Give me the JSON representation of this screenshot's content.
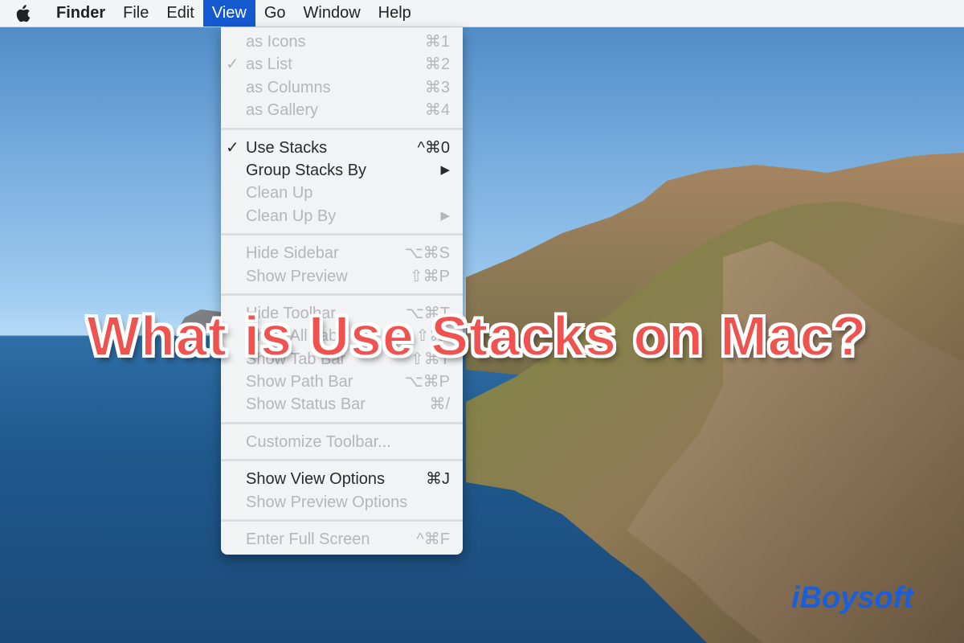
{
  "menubar": {
    "apple_icon": "apple-logo-icon",
    "items": [
      "Finder",
      "File",
      "Edit",
      "View",
      "Go",
      "Window",
      "Help"
    ],
    "active_item": "View"
  },
  "view_menu": {
    "groups": [
      [
        {
          "label": "as Icons",
          "shortcut": "⌘1",
          "enabled": false,
          "checked": false
        },
        {
          "label": "as List",
          "shortcut": "⌘2",
          "enabled": false,
          "checked": true
        },
        {
          "label": "as Columns",
          "shortcut": "⌘3",
          "enabled": false,
          "checked": false
        },
        {
          "label": "as Gallery",
          "shortcut": "⌘4",
          "enabled": false,
          "checked": false
        }
      ],
      [
        {
          "label": "Use Stacks",
          "shortcut": "^⌘0",
          "enabled": true,
          "checked": true
        },
        {
          "label": "Group Stacks By",
          "shortcut": "▶",
          "enabled": true,
          "checked": false
        },
        {
          "label": "Clean Up",
          "shortcut": "",
          "enabled": false,
          "checked": false
        },
        {
          "label": "Clean Up By",
          "shortcut": "▶",
          "enabled": false,
          "checked": false
        }
      ],
      [
        {
          "label": "Hide Sidebar",
          "shortcut": "⌥⌘S",
          "enabled": false,
          "checked": false
        },
        {
          "label": "Show Preview",
          "shortcut": "⇧⌘P",
          "enabled": false,
          "checked": false
        }
      ],
      [
        {
          "label": "Hide Toolbar",
          "shortcut": "⌥⌘T",
          "enabled": false,
          "checked": false
        },
        {
          "label": "Show All Tabs",
          "shortcut": "⇧⌘\\",
          "enabled": false,
          "checked": false
        },
        {
          "label": "Show Tab Bar",
          "shortcut": "⇧⌘T",
          "enabled": false,
          "checked": false
        },
        {
          "label": "Show Path Bar",
          "shortcut": "⌥⌘P",
          "enabled": false,
          "checked": false
        },
        {
          "label": "Show Status Bar",
          "shortcut": "⌘/",
          "enabled": false,
          "checked": false
        }
      ],
      [
        {
          "label": "Customize Toolbar...",
          "shortcut": "",
          "enabled": false,
          "checked": false
        }
      ],
      [
        {
          "label": "Show View Options",
          "shortcut": "⌘J",
          "enabled": true,
          "checked": false
        },
        {
          "label": "Show Preview Options",
          "shortcut": "",
          "enabled": false,
          "checked": false
        }
      ],
      [
        {
          "label": "Enter Full Screen",
          "shortcut": "^⌘F",
          "enabled": false,
          "checked": false
        }
      ]
    ],
    "check_glyph": "✓"
  },
  "overlay": {
    "title": "What is Use Stacks on Mac?",
    "title_color": "#ef5350",
    "watermark": "iBoysoft",
    "watermark_color": "#1a5fd8"
  },
  "colors": {
    "menubar_bg": "#f3f4f6",
    "selected_menu_bg": "#1559d1",
    "menu_bg": "#f2f3f5"
  }
}
